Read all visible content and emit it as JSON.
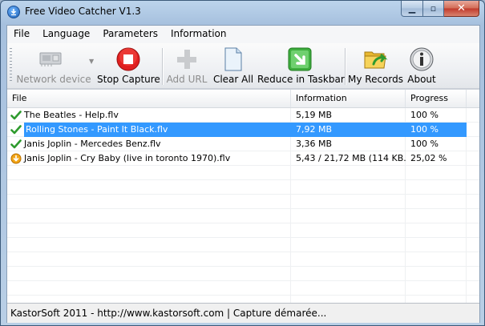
{
  "window": {
    "title": "Free Video Catcher V1.3"
  },
  "menu": [
    "File",
    "Language",
    "Parameters",
    "Information"
  ],
  "toolbar": {
    "network_device": "Network device",
    "stop_capture": "Stop Capture",
    "add_url": "Add URL",
    "clear_all": "Clear All",
    "reduce_taskbar": "Reduce in Taskbar",
    "my_records": "My Records",
    "about": "About"
  },
  "list": {
    "columns": [
      "File",
      "Information",
      "Progress"
    ],
    "rows": [
      {
        "file": "The Beatles - Help.flv",
        "info": "5,19 MB",
        "progress": "100 %",
        "status_icon": "check-icon"
      },
      {
        "file": "Rolling Stones - Paint It Black.flv",
        "info": "7,92 MB",
        "progress": "100 %",
        "status_icon": "check-icon",
        "selected": true
      },
      {
        "file": "Janis Joplin - Mercedes Benz.flv",
        "info": "3,36 MB",
        "progress": "100 %",
        "status_icon": "check-icon"
      },
      {
        "file": "Janis Joplin - Cry Baby (live in toronto 1970).flv",
        "info": "5,43 / 21,72 MB (114 KB...",
        "progress": "25,02 %",
        "status_icon": "downloading-icon"
      }
    ]
  },
  "status": {
    "text": "KastorSoft 2011 - http://www.kastorsoft.com  |  Capture démarée..."
  },
  "colors": {
    "selection": "#3399ff",
    "stop_red": "#e02020",
    "taskbar_green": "#3fae3f"
  }
}
